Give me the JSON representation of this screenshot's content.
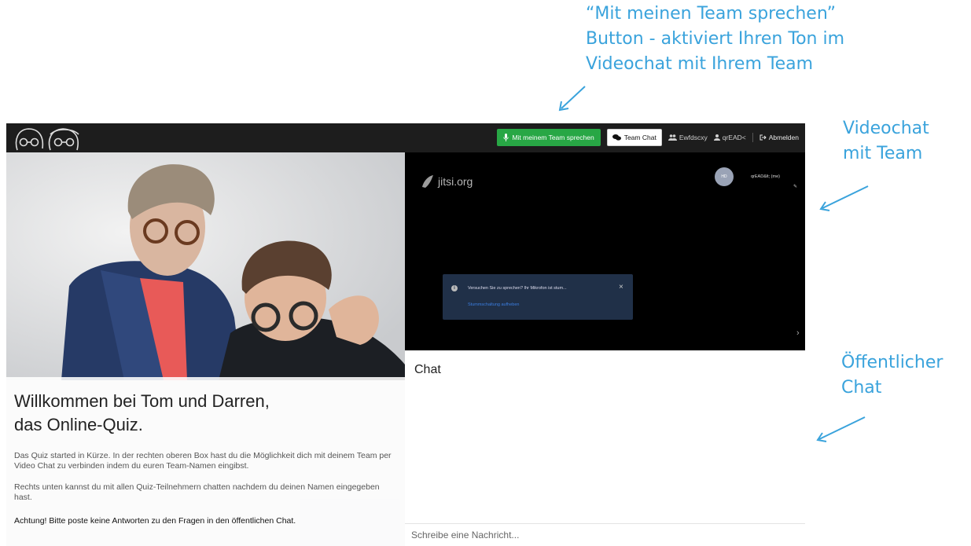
{
  "annotations": {
    "talk_button": [
      "“Mit meinen Team sprechen”",
      "Button - aktiviert Ihren Ton im",
      "Videochat mit Ihrem Team"
    ],
    "videochat": [
      "Videochat",
      "mit Team"
    ],
    "public_chat": [
      "Öffentlicher",
      "Chat"
    ]
  },
  "colors": {
    "annotation": "#3aa3dc",
    "talk_button": "#28a745",
    "topbar": "#1d1d1d"
  },
  "header": {
    "talk_label": "Mit meinem Team sprechen",
    "team_chat_label": "Team Chat",
    "team_name": "Ewfdscxy",
    "user_name": "qrEAD<",
    "logout_label": "Abmelden",
    "icons": [
      "microphone-icon",
      "chat-bubbles-icon",
      "users-icon",
      "user-icon",
      "sign-out-icon"
    ]
  },
  "welcome": {
    "title_line1": "Willkommen bei Tom und Darren,",
    "title_line2": "das Online-Quiz.",
    "paragraph1": "Das Quiz started in Kürze. In der rechten oberen Box hast du die Möglichkeit dich mit deinem Team per Video Chat zu verbinden indem du euren Team-Namen eingibst.",
    "paragraph2": "Rechts unten kannst du mit allen Quiz-Teilnehmern chatten nachdem du deinen Namen eingegeben hast.",
    "warning": "Achtung! Bitte poste keine Antworten zu den Fragen in den öffentlichen Chat."
  },
  "video": {
    "brand": "jitsi.org",
    "avatar_initials": "HD",
    "participant_name": "qrEAD&lt; (me)",
    "toast_text": "Versuchen Sie zu sprechen? Ihr Mikrofon ist stum...",
    "toast_link": "Stummschaltung aufheben",
    "close_symbol": "×",
    "chevron": "›"
  },
  "chat": {
    "title": "Chat",
    "input_placeholder": "Schreibe eine Nachricht..."
  }
}
